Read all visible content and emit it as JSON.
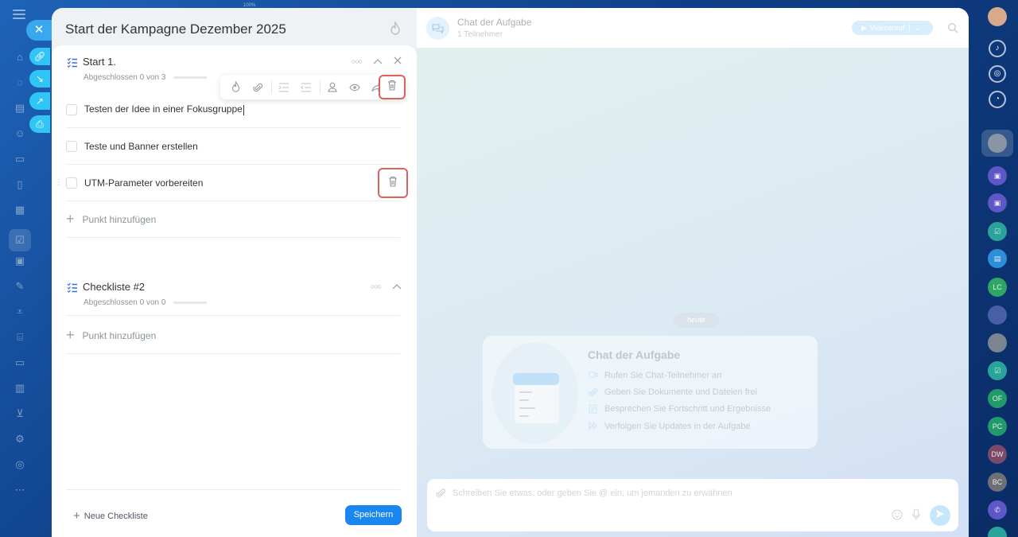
{
  "page": {
    "zoom_label": "100%"
  },
  "task": {
    "title": "Start der Kampagne Dezember 2025",
    "checklists": [
      {
        "name": "Start 1.",
        "progress": "Abgeschlossen 0 von 3",
        "progress_fraction": 0,
        "items": [
          {
            "text": "Testen der Idee in einer Fokusgruppe",
            "checked": false
          },
          {
            "text": "Teste und Banner erstellen",
            "checked": false
          },
          {
            "text": "UTM-Parameter vorbereiten",
            "checked": false
          }
        ],
        "add_item_label": "Punkt hinzufügen"
      },
      {
        "name": "Checkliste #2",
        "progress": "Abgeschlossen 0 von 0",
        "progress_fraction": 0,
        "items": [],
        "add_item_label": "Punkt hinzufügen"
      }
    ],
    "item_toolbar_icons": [
      "flame-icon",
      "paperclip-icon",
      "indent-icon",
      "outdent-icon",
      "user-icon",
      "eye-icon",
      "share-icon",
      "trash-icon"
    ],
    "footer": {
      "new_checklist_label": "Neue Checkliste",
      "save_label": "Speichern"
    }
  },
  "chat": {
    "title": "Chat der Aufgabe",
    "subtitle": "1 Teilnehmer",
    "video_call_label": "Videoanruf",
    "date_label": "heute",
    "welcome": {
      "title": "Chat der Aufgabe",
      "features": [
        {
          "icon": "camera-icon",
          "text": "Rufen Sie Chat-Teilnehmer an"
        },
        {
          "icon": "paperclip-icon",
          "text": "Geben Sie Dokumente und Dateien frei"
        },
        {
          "icon": "document-icon",
          "text": "Besprechen Sie Fortschritt und Ergebnisse"
        },
        {
          "icon": "forward-icon",
          "text": "Verfolgen Sie Updates in der Aufgabe"
        }
      ]
    },
    "composer_placeholder": "Schreiben Sie etwas, oder geben Sie @ ein, um jemanden zu erwähnen"
  },
  "rightbar": {
    "avatars": [
      "LC",
      "OF",
      "PC",
      "DW",
      "BC"
    ]
  },
  "colors": {
    "primary": "#1a86f0",
    "highlight": "#e0605b",
    "checklist_icon": "#2f6fd6",
    "background": "#0f3f86"
  }
}
